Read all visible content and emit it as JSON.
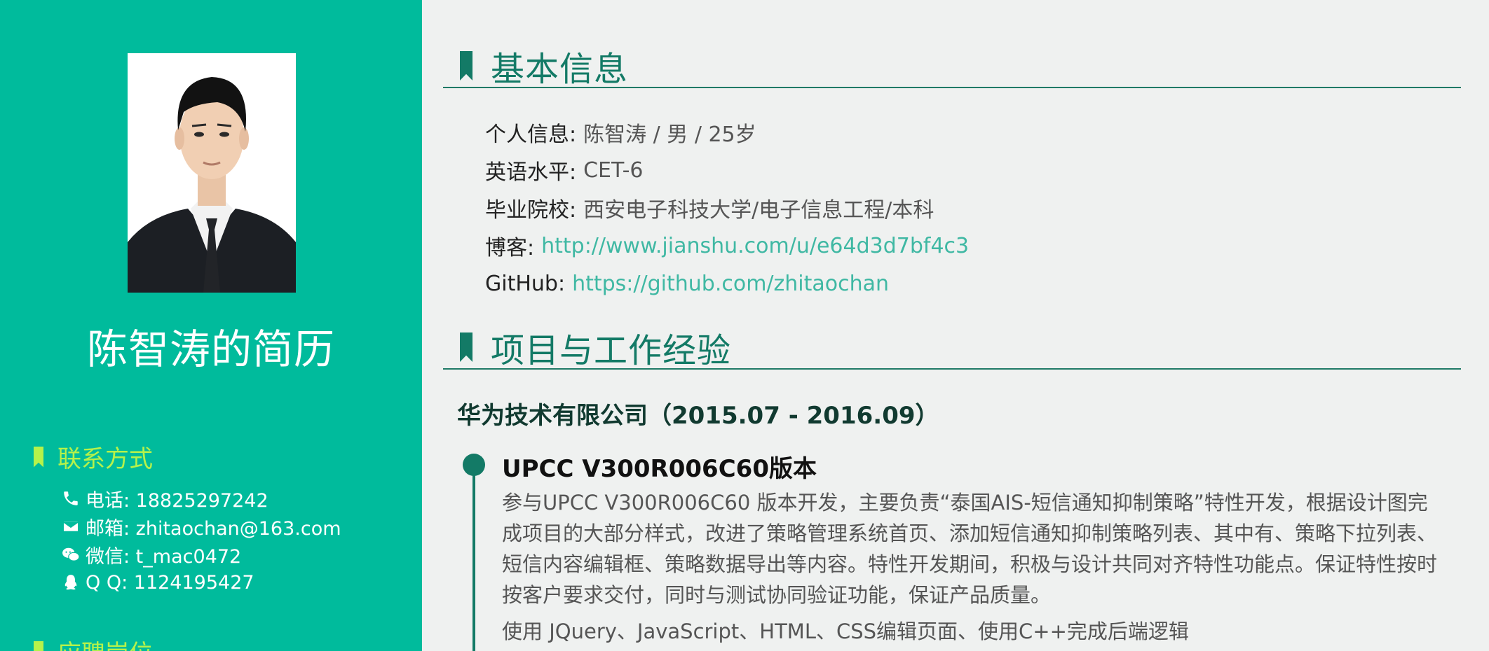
{
  "sidebar": {
    "name": "陈智涛的简历",
    "contact_heading": "联系方式",
    "contacts": [
      {
        "icon": "phone-icon",
        "text": "电话: 18825297242"
      },
      {
        "icon": "envelope-icon",
        "text": "邮箱: zhitaochan@163.com"
      },
      {
        "icon": "wechat-icon",
        "text": "微信: t_mac0472"
      },
      {
        "icon": "qq-penguin-icon",
        "text": "Q Q: 1124195427"
      }
    ],
    "position_heading": "应聘岗位"
  },
  "basic_info": {
    "title": "基本信息",
    "rows": [
      {
        "label": "个人信息:",
        "value": "陈智涛 / 男 / 25岁"
      },
      {
        "label": "英语水平:",
        "value": "CET-6"
      },
      {
        "label": "毕业院校:",
        "value": "西安电子科技大学/电子信息工程/本科"
      },
      {
        "label": "博客:",
        "value": "http://www.jianshu.com/u/e64d3d7bf4c3"
      },
      {
        "label": "GitHub:",
        "value": "https://github.com/zhitaochan"
      }
    ]
  },
  "experience": {
    "title": "项目与工作经验",
    "company": "华为技术有限公司（2015.07 - 2016.09）",
    "project_title": "UPCC V300R006C60版本",
    "project_desc": "参与UPCC V300R006C60 版本开发，主要负责“泰国AIS-短信通知抑制策略”特性开发，根据设计图完成项目的大部分样式，改进了策略管理系统首页、添加短信通知抑制策略列表、其中有、策略下拉列表、短信内容编辑框、策略数据导出等内容。特性开发期间，积极与设计共同对齐特性功能点。保证特性按时按客户要求交付，同时与测试协同验证功能，保证产品质量。",
    "project_tech": "使用 JQuery、JavaScript、HTML、CSS编辑页面、使用C++完成后端逻辑"
  },
  "colors": {
    "sidebar_bg": "#00bb9c",
    "accent_green": "#137a66",
    "sidebar_heading": "#b6f24a",
    "link": "#3fb8a3",
    "page_bg": "#eff1f0"
  }
}
